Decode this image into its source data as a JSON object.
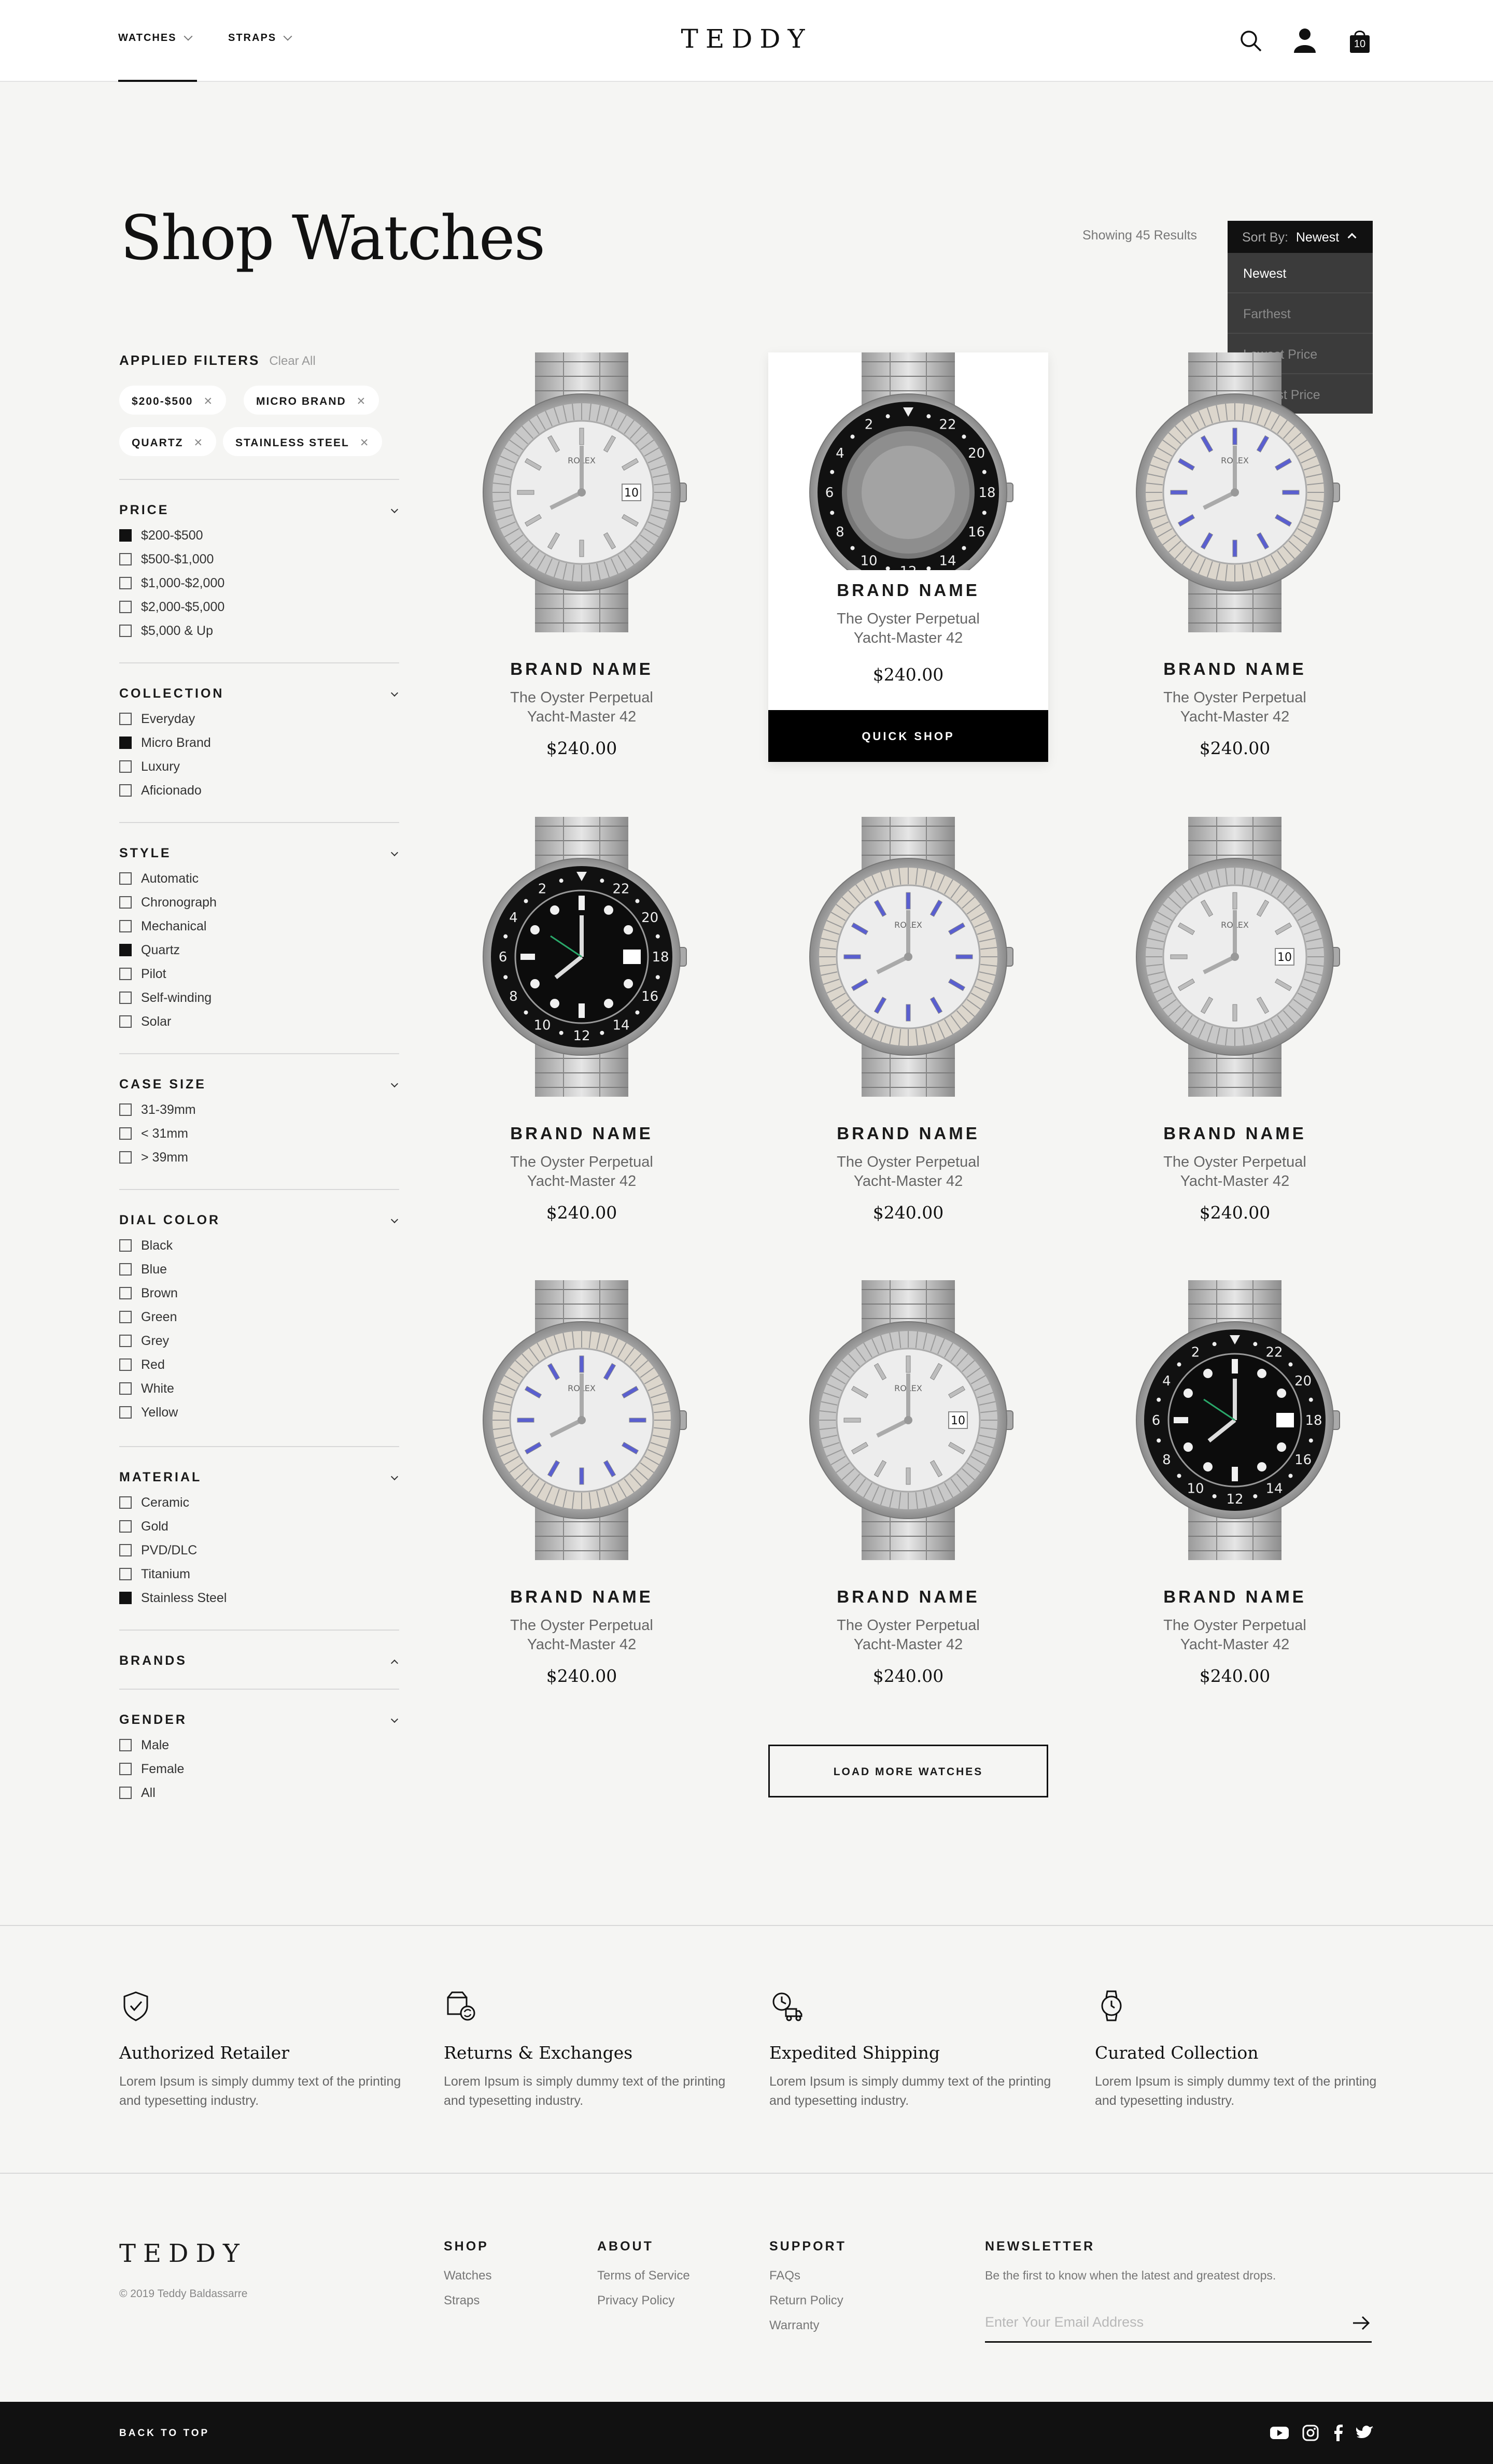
{
  "header": {
    "nav": [
      {
        "label": "WATCHES"
      },
      {
        "label": "STRAPS"
      }
    ],
    "logo": "TEDDY",
    "cart_count": "10",
    "icons": [
      "search-icon",
      "user-icon",
      "cart-icon"
    ]
  },
  "main": {
    "title": "Shop Watches",
    "results_text": "Showing 45 Results",
    "sort": {
      "label": "Sort By:",
      "value": "Newest",
      "options": [
        "Newest",
        "Farthest",
        "Lowest Price",
        "Highest Price"
      ]
    }
  },
  "filters": {
    "applied_title": "APPLIED FILTERS",
    "clear_all": "Clear All",
    "chips": [
      "$200-$500",
      "MICRO BRAND",
      "QUARTZ",
      "STAINLESS STEEL"
    ],
    "sections": [
      {
        "title": "PRICE",
        "options": [
          {
            "label": "$200-$500",
            "checked": true
          },
          {
            "label": "$500-$1,000",
            "checked": false
          },
          {
            "label": "$1,000-$2,000",
            "checked": false
          },
          {
            "label": "$2,000-$5,000",
            "checked": false
          },
          {
            "label": "$5,000 & Up",
            "checked": false
          }
        ]
      },
      {
        "title": "COLLECTION",
        "options": [
          {
            "label": "Everyday",
            "checked": false
          },
          {
            "label": "Micro Brand",
            "checked": true
          },
          {
            "label": "Luxury",
            "checked": false
          },
          {
            "label": "Aficionado",
            "checked": false
          }
        ]
      },
      {
        "title": "STYLE",
        "options": [
          {
            "label": "Automatic",
            "checked": false
          },
          {
            "label": "Chronograph",
            "checked": false
          },
          {
            "label": "Mechanical",
            "checked": false
          },
          {
            "label": "Quartz",
            "checked": true
          },
          {
            "label": "Pilot",
            "checked": false
          },
          {
            "label": "Self-winding",
            "checked": false
          },
          {
            "label": "Solar",
            "checked": false
          }
        ]
      },
      {
        "title": "CASE SIZE",
        "options": [
          {
            "label": "31-39mm",
            "checked": false
          },
          {
            "label": "< 31mm",
            "checked": false
          },
          {
            "label": "> 39mm",
            "checked": false
          }
        ]
      },
      {
        "title": "DIAL COLOR",
        "options": [
          {
            "label": "Black",
            "checked": false
          },
          {
            "label": "Blue",
            "checked": false
          },
          {
            "label": "Brown",
            "checked": false
          },
          {
            "label": "Green",
            "checked": false
          },
          {
            "label": "Grey",
            "checked": false
          },
          {
            "label": "Red",
            "checked": false
          },
          {
            "label": "White",
            "checked": false
          },
          {
            "label": "Yellow",
            "checked": false
          }
        ]
      },
      {
        "title": "MATERIAL",
        "options": [
          {
            "label": "Ceramic",
            "checked": false
          },
          {
            "label": "Gold",
            "checked": false
          },
          {
            "label": "PVD/DLC",
            "checked": false
          },
          {
            "label": "Titanium",
            "checked": false
          },
          {
            "label": "Stainless Steel",
            "checked": true
          }
        ]
      },
      {
        "title": "BRANDS",
        "options": []
      },
      {
        "title": "GENDER",
        "options": [
          {
            "label": "Male",
            "checked": false
          },
          {
            "label": "Female",
            "checked": false
          },
          {
            "label": "All",
            "checked": false
          }
        ]
      }
    ]
  },
  "products": [
    {
      "brand": "BRAND NAME",
      "model_line1": "The Oyster Perpetual",
      "model_line2": "Yacht-Master 42",
      "price": "$240.00",
      "dial": "white-fluted"
    },
    {
      "brand": "BRAND NAME",
      "model_line1": "The Oyster Perpetual",
      "model_line2": "Yacht-Master 42",
      "price": "$240.00",
      "dial": "black-bezel-blurred",
      "quick_shop": "QUICK SHOP"
    },
    {
      "brand": "BRAND NAME",
      "model_line1": "The Oyster Perpetual",
      "model_line2": "Yacht-Master 42",
      "price": "$240.00",
      "dial": "white-blue"
    },
    {
      "brand": "BRAND NAME",
      "model_line1": "The Oyster Perpetual",
      "model_line2": "Yacht-Master 42",
      "price": "$240.00",
      "dial": "black-gmt"
    },
    {
      "brand": "BRAND NAME",
      "model_line1": "The Oyster Perpetual",
      "model_line2": "Yacht-Master 42",
      "price": "$240.00",
      "dial": "white-blue"
    },
    {
      "brand": "BRAND NAME",
      "model_line1": "The Oyster Perpetual",
      "model_line2": "Yacht-Master 42",
      "price": "$240.00",
      "dial": "white-fluted"
    },
    {
      "brand": "BRAND NAME",
      "model_line1": "The Oyster Perpetual",
      "model_line2": "Yacht-Master 42",
      "price": "$240.00",
      "dial": "white-blue"
    },
    {
      "brand": "BRAND NAME",
      "model_line1": "The Oyster Perpetual",
      "model_line2": "Yacht-Master 42",
      "price": "$240.00",
      "dial": "white-fluted"
    },
    {
      "brand": "BRAND NAME",
      "model_line1": "The Oyster Perpetual",
      "model_line2": "Yacht-Master 42",
      "price": "$240.00",
      "dial": "black-gmt"
    }
  ],
  "load_more": "LOAD MORE WATCHES",
  "features": [
    {
      "icon": "shield-check-icon",
      "title": "Authorized Retailer",
      "text": "Lorem Ipsum is simply dummy text of the printing and typesetting industry."
    },
    {
      "icon": "box-exchange-icon",
      "title": "Returns & Exchanges",
      "text": "Lorem Ipsum is simply dummy text of the printing and typesetting industry."
    },
    {
      "icon": "clock-truck-icon",
      "title": "Expedited Shipping",
      "text": "Lorem Ipsum is simply dummy text of the printing and typesetting industry."
    },
    {
      "icon": "watch-icon",
      "title": "Curated Collection",
      "text": "Lorem Ipsum is simply dummy text of the printing and typesetting industry."
    }
  ],
  "footer": {
    "logo": "TEDDY",
    "copyright": "© 2019 Teddy Baldassarre",
    "shop": {
      "title": "SHOP",
      "links": [
        "Watches",
        "Straps"
      ]
    },
    "about": {
      "title": "ABOUT",
      "links": [
        "Terms of Service",
        "Privacy Policy"
      ]
    },
    "support": {
      "title": "SUPPORT",
      "links": [
        "FAQs",
        "Return Policy",
        "Warranty"
      ]
    },
    "newsletter": {
      "title": "NEWSLETTER",
      "text": "Be the first to know when the latest and greatest drops.",
      "placeholder": "Enter Your Email Address"
    },
    "back_to_top": "BACK TO TOP",
    "social": [
      "youtube-icon",
      "instagram-icon",
      "facebook-icon",
      "twitter-icon"
    ]
  },
  "colors": {
    "accent": "#111111",
    "background": "#f5f5f3",
    "menu_bg": "#3b3b3b"
  }
}
